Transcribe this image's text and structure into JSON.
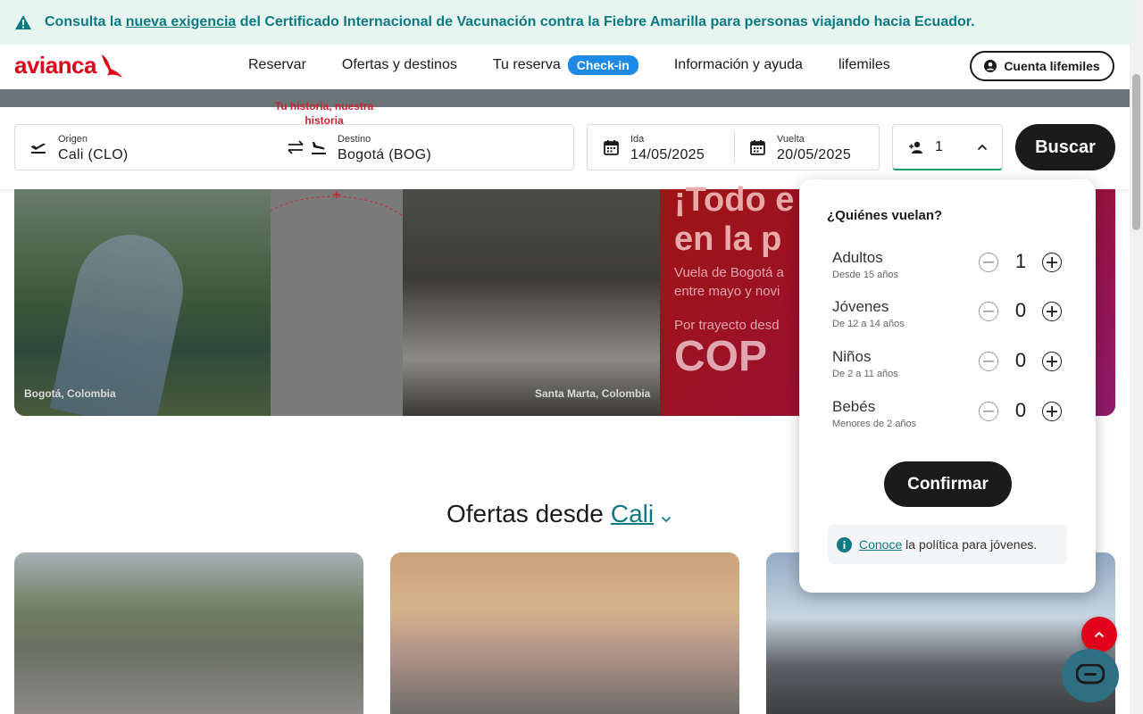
{
  "alert": {
    "prefix": "Consulta la",
    "link": "nueva exigencia",
    "suffix": "del Certificado Internacional de Vacunación contra la Fiebre Amarilla para personas viajando hacia Ecuador."
  },
  "header": {
    "logo": "avianca",
    "nav": [
      "Reservar",
      "Ofertas y destinos",
      "Tu reserva",
      "Información y ayuda",
      "lifemiles"
    ],
    "checkin_badge": "Check-in",
    "account_button": "Cuenta lifemiles"
  },
  "search": {
    "origin_label": "Origen",
    "origin_value": "Cali  (CLO)",
    "destination_label": "Destino",
    "destination_value": "Bogotá  (BOG)",
    "depart_label": "Ida",
    "depart_value": "14/05/2025",
    "return_label": "Vuelta",
    "return_value": "20/05/2025",
    "passengers": "1",
    "search_button": "Buscar"
  },
  "hero": {
    "left_caption": "Bogotá, Colombia",
    "mid_text": "Tu historia, nuestra historia",
    "right_caption": "Santa Marta, Colombia",
    "promo_title_1": "¡Todo e",
    "promo_title_2": "en la p",
    "promo_sub_1": "Vuela de Bogotá a",
    "promo_sub_2": "entre mayo y novi",
    "promo_from": "Por trayecto desd",
    "promo_price": "COP"
  },
  "offers": {
    "title": "Ofertas desde",
    "city": "Cali"
  },
  "popup": {
    "title": "¿Quiénes vuelan?",
    "rows": [
      {
        "name": "Adultos",
        "desc": "Desde 15 años",
        "count": "1"
      },
      {
        "name": "Jóvenes",
        "desc": "De 12 a 14 años",
        "count": "0"
      },
      {
        "name": "Niños",
        "desc": "De 2 a 11 años",
        "count": "0"
      },
      {
        "name": "Bebés",
        "desc": "Menores de 2 años",
        "count": "0"
      }
    ],
    "confirm_button": "Confirmar",
    "policy_link": "Conoce",
    "policy_text": "la política para jóvenes."
  },
  "colors": {
    "brand_red": "#e0001b",
    "teal": "#0d7a83",
    "badge_blue": "#1e8ae6"
  }
}
